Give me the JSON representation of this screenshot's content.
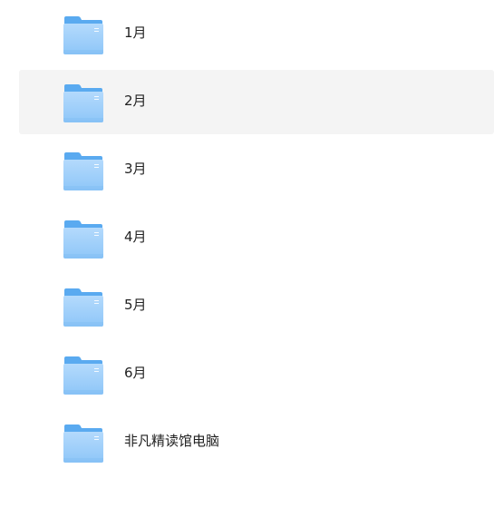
{
  "files": [
    {
      "name": "1月",
      "icon": "folder-icon"
    },
    {
      "name": "2月",
      "icon": "folder-icon",
      "state": "hover"
    },
    {
      "name": "3月",
      "icon": "folder-icon"
    },
    {
      "name": "4月",
      "icon": "folder-icon"
    },
    {
      "name": "5月",
      "icon": "folder-icon"
    },
    {
      "name": "6月",
      "icon": "folder-icon"
    },
    {
      "name": "非凡精读馆电脑",
      "icon": "folder-icon"
    }
  ],
  "colors": {
    "folder_back": "#5aaaf0",
    "folder_front_top": "#a6d3fb",
    "folder_front_bottom": "#8cc5f8",
    "hover_bg": "#f4f4f4",
    "text": "#222222"
  }
}
